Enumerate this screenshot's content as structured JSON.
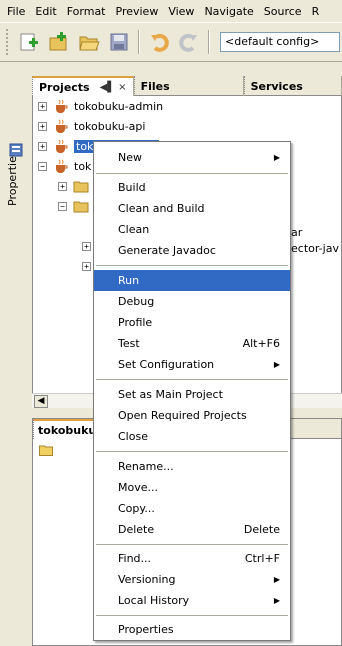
{
  "menubar": [
    "File",
    "Edit",
    "Format",
    "Preview",
    "View",
    "Navigate",
    "Source",
    "R"
  ],
  "toolbar": {
    "config": "<default config>"
  },
  "sidebar": {
    "properties_label": "Properties"
  },
  "projects_panel": {
    "tabs": [
      {
        "label": "Projects",
        "active": true
      },
      {
        "label": "Files",
        "active": false
      },
      {
        "label": "Services",
        "active": false
      }
    ],
    "tab_controls": "◀▌ ×"
  },
  "tree": [
    {
      "label": "tokobuku-admin",
      "selected": false
    },
    {
      "label": "tokobuku-api",
      "selected": false
    },
    {
      "label": "tokobuku-kasir",
      "selected": true
    },
    {
      "label": "tok",
      "selected": false
    }
  ],
  "peek_text": [
    "ar",
    "ector-jav"
  ],
  "bottom_panel": {
    "title": "tokobuku"
  },
  "context_menu": {
    "items": [
      {
        "label": "New",
        "shortcut": "",
        "submenu": true
      },
      {
        "sep": true
      },
      {
        "label": "Build",
        "shortcut": ""
      },
      {
        "label": "Clean and Build",
        "shortcut": ""
      },
      {
        "label": "Clean",
        "shortcut": ""
      },
      {
        "label": "Generate Javadoc",
        "shortcut": ""
      },
      {
        "sep": true
      },
      {
        "label": "Run",
        "shortcut": "",
        "highlighted": true
      },
      {
        "label": "Debug",
        "shortcut": ""
      },
      {
        "label": "Profile",
        "shortcut": ""
      },
      {
        "label": "Test",
        "shortcut": "Alt+F6"
      },
      {
        "label": "Set Configuration",
        "shortcut": "",
        "submenu": true
      },
      {
        "sep": true
      },
      {
        "label": "Set as Main Project",
        "shortcut": ""
      },
      {
        "label": "Open Required Projects",
        "shortcut": ""
      },
      {
        "label": "Close",
        "shortcut": ""
      },
      {
        "sep": true
      },
      {
        "label": "Rename...",
        "shortcut": ""
      },
      {
        "label": "Move...",
        "shortcut": ""
      },
      {
        "label": "Copy...",
        "shortcut": ""
      },
      {
        "label": "Delete",
        "shortcut": "Delete"
      },
      {
        "sep": true
      },
      {
        "label": "Find...",
        "shortcut": "Ctrl+F"
      },
      {
        "label": "Versioning",
        "shortcut": "",
        "submenu": true
      },
      {
        "label": "Local History",
        "shortcut": "",
        "submenu": true
      },
      {
        "sep": true
      },
      {
        "label": "Properties",
        "shortcut": ""
      }
    ]
  },
  "colors": {
    "highlight": "#316ac5",
    "chrome": "#ece9d8",
    "tab_accent": "#e0a040"
  }
}
